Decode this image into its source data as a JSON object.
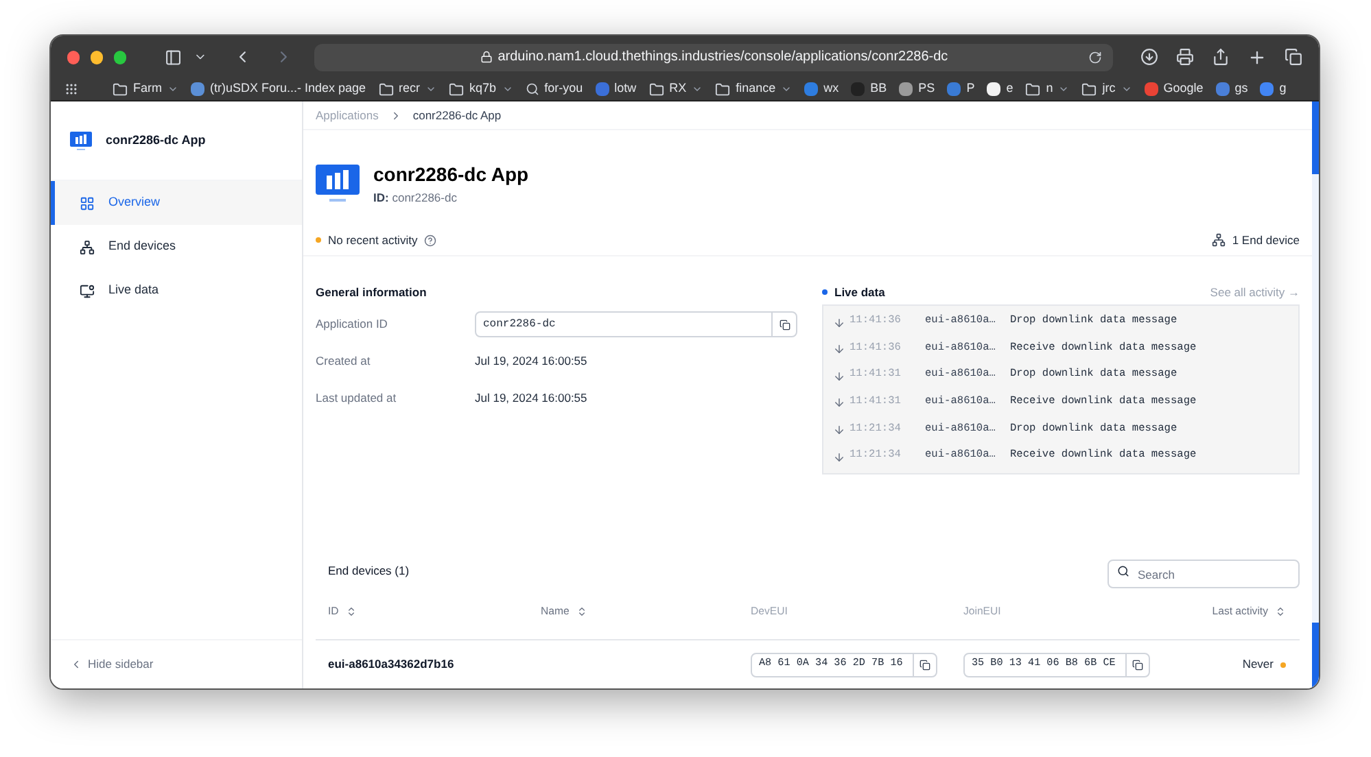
{
  "browser": {
    "url": "arduino.nam1.cloud.thethings.industries/console/applications/conr2286-dc",
    "bookmarks": [
      {
        "label": "Farm",
        "kind": "folder"
      },
      {
        "label": "(tr)uSDX Foru...- Index page",
        "kind": "site",
        "color": "#5b8fd6"
      },
      {
        "label": "recr",
        "kind": "folder"
      },
      {
        "label": "kq7b",
        "kind": "folder"
      },
      {
        "label": "for-you",
        "kind": "pin"
      },
      {
        "label": "lotw",
        "kind": "site",
        "color": "#3b6fd8"
      },
      {
        "label": "RX",
        "kind": "folder"
      },
      {
        "label": "finance",
        "kind": "folder"
      },
      {
        "label": "wx",
        "kind": "site",
        "color": "#2e7de0"
      },
      {
        "label": "BB",
        "kind": "site",
        "color": "#222222"
      },
      {
        "label": "PS",
        "kind": "site",
        "color": "#9a9a9a"
      },
      {
        "label": "P",
        "kind": "site",
        "color": "#3a7bd5"
      },
      {
        "label": "e",
        "kind": "site",
        "color": "#f2f2f2"
      },
      {
        "label": "n",
        "kind": "folder"
      },
      {
        "label": "jrc",
        "kind": "folder"
      },
      {
        "label": "Google",
        "kind": "site",
        "color": "#ea4335"
      },
      {
        "label": "gs",
        "kind": "site",
        "color": "#4a7fd8"
      },
      {
        "label": "g",
        "kind": "site",
        "color": "#4285f4"
      }
    ]
  },
  "sidebar": {
    "app_name": "conr2286-dc App",
    "items": [
      {
        "label": "Overview",
        "selected": true
      },
      {
        "label": "End devices",
        "selected": false
      },
      {
        "label": "Live data",
        "selected": false
      }
    ],
    "hide_label": "Hide sidebar"
  },
  "breadcrumbs": [
    "Applications",
    "conr2286-dc App"
  ],
  "header": {
    "title": "conr2286-dc App",
    "id_label": "ID:",
    "id_value": "conr2286-dc"
  },
  "activity": {
    "status": "No recent activity",
    "end_devices": "1 End device"
  },
  "general": {
    "title": "General information",
    "rows": [
      {
        "label": "Application ID",
        "value": "conr2286-dc",
        "kind": "field"
      },
      {
        "label": "Created at",
        "value": "Jul 19, 2024 16:00:55",
        "kind": "text"
      },
      {
        "label": "Last updated at",
        "value": "Jul 19, 2024 16:00:55",
        "kind": "text"
      }
    ]
  },
  "live_data": {
    "title": "Live data",
    "link": "See all activity →",
    "events": [
      {
        "time": "11:41:36",
        "device": "eui-a8610a…",
        "message": "Drop downlink data message"
      },
      {
        "time": "11:41:36",
        "device": "eui-a8610a…",
        "message": "Receive downlink data message"
      },
      {
        "time": "11:41:31",
        "device": "eui-a8610a…",
        "message": "Drop downlink data message"
      },
      {
        "time": "11:41:31",
        "device": "eui-a8610a…",
        "message": "Receive downlink data message"
      },
      {
        "time": "11:21:34",
        "device": "eui-a8610a…",
        "message": "Drop downlink data message"
      },
      {
        "time": "11:21:34",
        "device": "eui-a8610a…",
        "message": "Receive downlink data message"
      }
    ]
  },
  "end_devices": {
    "title": "End devices (1)",
    "search": {
      "placeholder": "Search"
    },
    "columns": [
      {
        "label": "ID",
        "sortable": true
      },
      {
        "label": "Name",
        "sortable": true
      },
      {
        "label": "DevEUI",
        "sortable": false
      },
      {
        "label": "JoinEUI",
        "sortable": false
      },
      {
        "label": "Last activity",
        "sortable": true
      }
    ],
    "rows": [
      {
        "id": "eui-a8610a34362d7b16",
        "name": "",
        "dev_eui": "A8 61 0A 34 36 2D 7B 16",
        "join_eui": "35 B0 13 41 06 B8 6B CE",
        "last_activity": "Never"
      }
    ]
  }
}
